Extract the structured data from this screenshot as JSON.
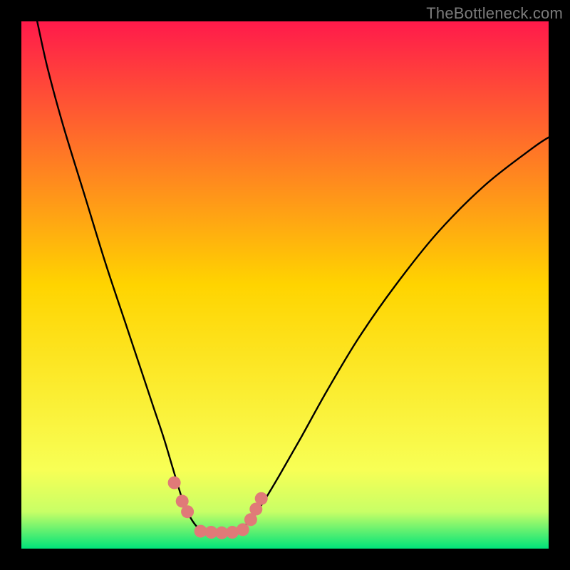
{
  "watermark": "TheBottleneck.com",
  "chart_data": {
    "type": "line",
    "title": "",
    "xlabel": "",
    "ylabel": "",
    "xlim": [
      0,
      100
    ],
    "ylim": [
      0,
      100
    ],
    "grid": false,
    "legend": false,
    "background_gradient": {
      "stops": [
        {
          "offset": 0.0,
          "color": "#ff1a4b"
        },
        {
          "offset": 0.5,
          "color": "#ffd400"
        },
        {
          "offset": 0.85,
          "color": "#f8ff55"
        },
        {
          "offset": 0.93,
          "color": "#c8ff66"
        },
        {
          "offset": 1.0,
          "color": "#00e37a"
        }
      ]
    },
    "series": [
      {
        "name": "left-curve",
        "color": "#000000",
        "x": [
          3,
          5,
          8,
          12,
          16,
          20,
          23,
          25,
          27,
          28.5,
          30,
          31,
          32,
          33,
          34
        ],
        "y": [
          100,
          91,
          80,
          67,
          54,
          42,
          33,
          27,
          21,
          16,
          11,
          8,
          6,
          4.5,
          3.5
        ]
      },
      {
        "name": "right-curve",
        "color": "#000000",
        "x": [
          42,
          44,
          46,
          49,
          53,
          58,
          64,
          71,
          79,
          88,
          97,
          100
        ],
        "y": [
          4,
          6,
          9,
          14,
          21,
          30,
          40,
          50,
          60,
          69,
          76,
          78
        ]
      },
      {
        "name": "valley-floor",
        "color": "#000000",
        "x": [
          34,
          36,
          38,
          40,
          42
        ],
        "y": [
          3.5,
          3.2,
          3.1,
          3.3,
          4
        ]
      }
    ],
    "markers": {
      "name": "floor-markers",
      "color": "#e07a78",
      "radius_px": 9,
      "points": [
        {
          "x": 29.0,
          "y": 12.5
        },
        {
          "x": 30.5,
          "y": 9.0
        },
        {
          "x": 31.5,
          "y": 7.0
        },
        {
          "x": 34.0,
          "y": 3.3
        },
        {
          "x": 36.0,
          "y": 3.1
        },
        {
          "x": 38.0,
          "y": 3.0
        },
        {
          "x": 40.0,
          "y": 3.1
        },
        {
          "x": 42.0,
          "y": 3.6
        },
        {
          "x": 43.5,
          "y": 5.5
        },
        {
          "x": 44.5,
          "y": 7.5
        },
        {
          "x": 45.5,
          "y": 9.5
        }
      ]
    }
  }
}
